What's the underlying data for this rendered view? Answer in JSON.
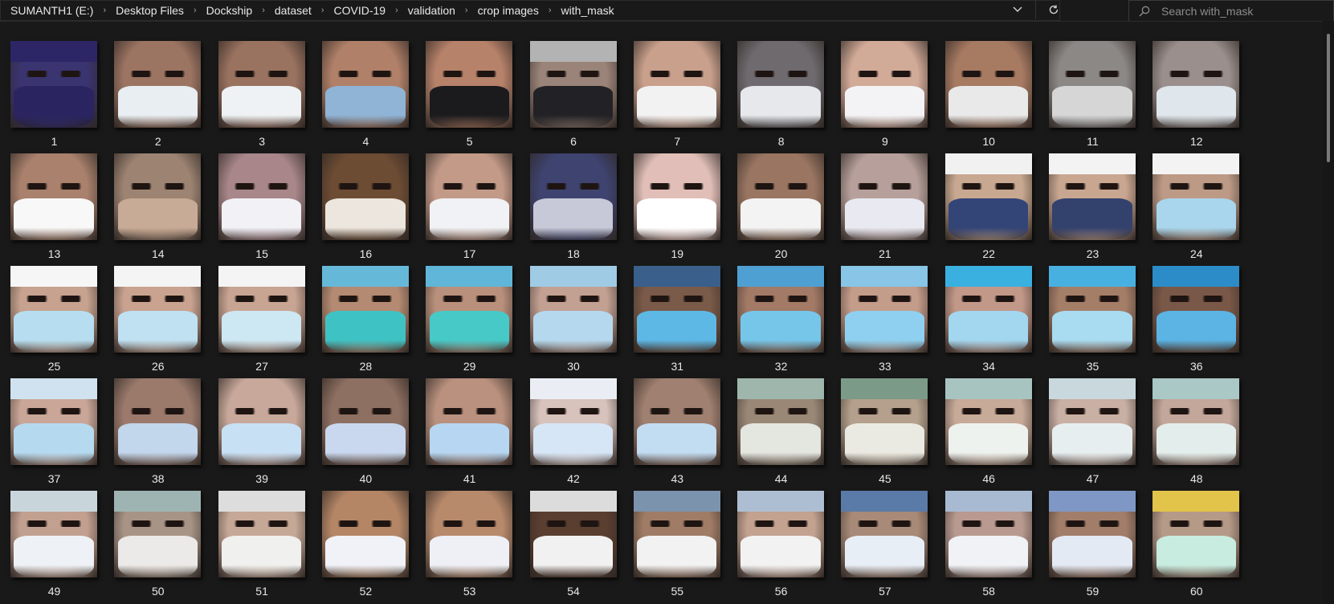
{
  "breadcrumb": [
    "SUMANTH1 (E:)",
    "Desktop Files",
    "Dockship",
    "dataset",
    "COVID-19",
    "validation",
    "crop images",
    "with_mask"
  ],
  "nav": {
    "dropdown_icon": "chevron-down-icon",
    "refresh_icon": "refresh-icon"
  },
  "search": {
    "placeholder": "Search with_mask",
    "icon": "search-icon"
  },
  "files": [
    {
      "name": "1",
      "skin": "#3a3470",
      "mask": "#2a2560",
      "cap": "#2c2667"
    },
    {
      "name": "2",
      "skin": "#9c7462",
      "mask": "#e8eef2",
      "cap": ""
    },
    {
      "name": "3",
      "skin": "#9a7260",
      "mask": "#eef2f4",
      "cap": ""
    },
    {
      "name": "4",
      "skin": "#b08068",
      "mask": "#8fb4d6",
      "cap": ""
    },
    {
      "name": "5",
      "skin": "#b7826a",
      "mask": "#1b1b1e",
      "cap": ""
    },
    {
      "name": "6",
      "skin": "#9a8378",
      "mask": "#222226",
      "cap": "#b3b3b3"
    },
    {
      "name": "7",
      "skin": "#c9a08c",
      "mask": "#f2f2f2",
      "cap": ""
    },
    {
      "name": "8",
      "skin": "#6e6a6e",
      "mask": "#e6e8ec",
      "cap": ""
    },
    {
      "name": "9",
      "skin": "#d2aa98",
      "mask": "#f3f3f6",
      "cap": ""
    },
    {
      "name": "10",
      "skin": "#a77a62",
      "mask": "#e9e9e9",
      "cap": ""
    },
    {
      "name": "11",
      "skin": "#8c8886",
      "mask": "#d6d6d6",
      "cap": ""
    },
    {
      "name": "12",
      "skin": "#9a8f8c",
      "mask": "#dfe6ec",
      "cap": ""
    },
    {
      "name": "13",
      "skin": "#a9816d",
      "mask": "#f8f8f8",
      "cap": ""
    },
    {
      "name": "14",
      "skin": "#9d8472",
      "mask": "#c8ab96",
      "cap": ""
    },
    {
      "name": "15",
      "skin": "#a8868a",
      "mask": "#f1f1f6",
      "cap": ""
    },
    {
      "name": "16",
      "skin": "#6d4c34",
      "mask": "#ece6de",
      "cap": ""
    },
    {
      "name": "17",
      "skin": "#c39a88",
      "mask": "#f0f2f5",
      "cap": ""
    },
    {
      "name": "18",
      "skin": "#3e4370",
      "mask": "#c7c9d8",
      "cap": ""
    },
    {
      "name": "19",
      "skin": "#e1bfb8",
      "mask": "#ffffff",
      "cap": ""
    },
    {
      "name": "20",
      "skin": "#9a7662",
      "mask": "#f3f3f3",
      "cap": ""
    },
    {
      "name": "21",
      "skin": "#b7a09b",
      "mask": "#e9e9f1",
      "cap": ""
    },
    {
      "name": "22",
      "skin": "#c8a890",
      "mask": "#334477",
      "cap": "#f1f1f1"
    },
    {
      "name": "23",
      "skin": "#c8a690",
      "mask": "#33416d",
      "cap": "#f3f3f3"
    },
    {
      "name": "24",
      "skin": "#bd9a86",
      "mask": "#a9d6ec",
      "cap": "#f3f3f3"
    },
    {
      "name": "25",
      "skin": "#c6a28f",
      "mask": "#b6def0",
      "cap": "#f6f6f6"
    },
    {
      "name": "26",
      "skin": "#c9a390",
      "mask": "#bfe1f2",
      "cap": "#f4f4f4"
    },
    {
      "name": "27",
      "skin": "#c8a492",
      "mask": "#cde7f3",
      "cap": "#f4f4f4"
    },
    {
      "name": "28",
      "skin": "#b48a72",
      "mask": "#3fc2c4",
      "cap": "#66b8d8"
    },
    {
      "name": "29",
      "skin": "#b9907c",
      "mask": "#47c9c8",
      "cap": "#5fb6d8"
    },
    {
      "name": "30",
      "skin": "#c2a092",
      "mask": "#b5d8ee",
      "cap": "#9fcbe4"
    },
    {
      "name": "31",
      "skin": "#7a5a48",
      "mask": "#5eb8e6",
      "cap": "#3a5f8a"
    },
    {
      "name": "32",
      "skin": "#a27a66",
      "mask": "#76c6ea",
      "cap": "#4ea0d2"
    },
    {
      "name": "33",
      "skin": "#c49c8a",
      "mask": "#8fd0f0",
      "cap": "#88c5e6"
    },
    {
      "name": "34",
      "skin": "#c29888",
      "mask": "#a3d6ef",
      "cap": "#3ab0e0"
    },
    {
      "name": "35",
      "skin": "#a57e68",
      "mask": "#a9dbf1",
      "cap": "#48b0e0"
    },
    {
      "name": "36",
      "skin": "#7a5848",
      "mask": "#5bb4e4",
      "cap": "#2c8cc8"
    },
    {
      "name": "37",
      "skin": "#c9a698",
      "mask": "#b5daf0",
      "cap": "#d0e2f0"
    },
    {
      "name": "38",
      "skin": "#9b7a6c",
      "mask": "#c2d6ec",
      "cap": ""
    },
    {
      "name": "39",
      "skin": "#c8a89a",
      "mask": "#c8e0f4",
      "cap": ""
    },
    {
      "name": "40",
      "skin": "#8e7062",
      "mask": "#c9d8ee",
      "cap": ""
    },
    {
      "name": "41",
      "skin": "#b9917e",
      "mask": "#b6d6f1",
      "cap": ""
    },
    {
      "name": "42",
      "skin": "#d7c2bc",
      "mask": "#d7e6f6",
      "cap": "#eaeef4"
    },
    {
      "name": "43",
      "skin": "#a08070",
      "mask": "#c2dcf2",
      "cap": ""
    },
    {
      "name": "44",
      "skin": "#9a8876",
      "mask": "#e4e6e0",
      "cap": "#9fb6ad"
    },
    {
      "name": "45",
      "skin": "#b4a08c",
      "mask": "#eaeae2",
      "cap": "#7c9a88"
    },
    {
      "name": "46",
      "skin": "#c7aa98",
      "mask": "#eef2ee",
      "cap": "#a8c4c0"
    },
    {
      "name": "47",
      "skin": "#c9b0a4",
      "mask": "#e6eef0",
      "cap": "#c9d8dc"
    },
    {
      "name": "48",
      "skin": "#c3a79a",
      "mask": "#e3eeec",
      "cap": "#a9c8c6"
    },
    {
      "name": "49",
      "skin": "#c2a090",
      "mask": "#eef2f6",
      "cap": "#c8d6dc"
    },
    {
      "name": "50",
      "skin": "#a89486",
      "mask": "#eceae8",
      "cap": "#9eb4b2"
    },
    {
      "name": "51",
      "skin": "#c6a896",
      "mask": "#f0f0ee",
      "cap": "#dddddd"
    },
    {
      "name": "52",
      "skin": "#b48666",
      "mask": "#f0f2f8",
      "cap": ""
    },
    {
      "name": "53",
      "skin": "#b88a6c",
      "mask": "#eef0f6",
      "cap": ""
    },
    {
      "name": "54",
      "skin": "#5a3e30",
      "mask": "#f1f1f1",
      "cap": "#dcdcdc"
    },
    {
      "name": "55",
      "skin": "#a07c66",
      "mask": "#f2f2f2",
      "cap": "#7c93ad"
    },
    {
      "name": "56",
      "skin": "#c3a290",
      "mask": "#f2f2f2",
      "cap": "#aebed2"
    },
    {
      "name": "57",
      "skin": "#a88a78",
      "mask": "#e8eef6",
      "cap": "#5a7aa8"
    },
    {
      "name": "58",
      "skin": "#b89a90",
      "mask": "#f0f2f6",
      "cap": "#a8bad2"
    },
    {
      "name": "59",
      "skin": "#a27e6a",
      "mask": "#e4eaf4",
      "cap": "#7f97c4"
    },
    {
      "name": "60",
      "skin": "#b69a88",
      "mask": "#c8ece0",
      "cap": "#e2c44a"
    }
  ]
}
